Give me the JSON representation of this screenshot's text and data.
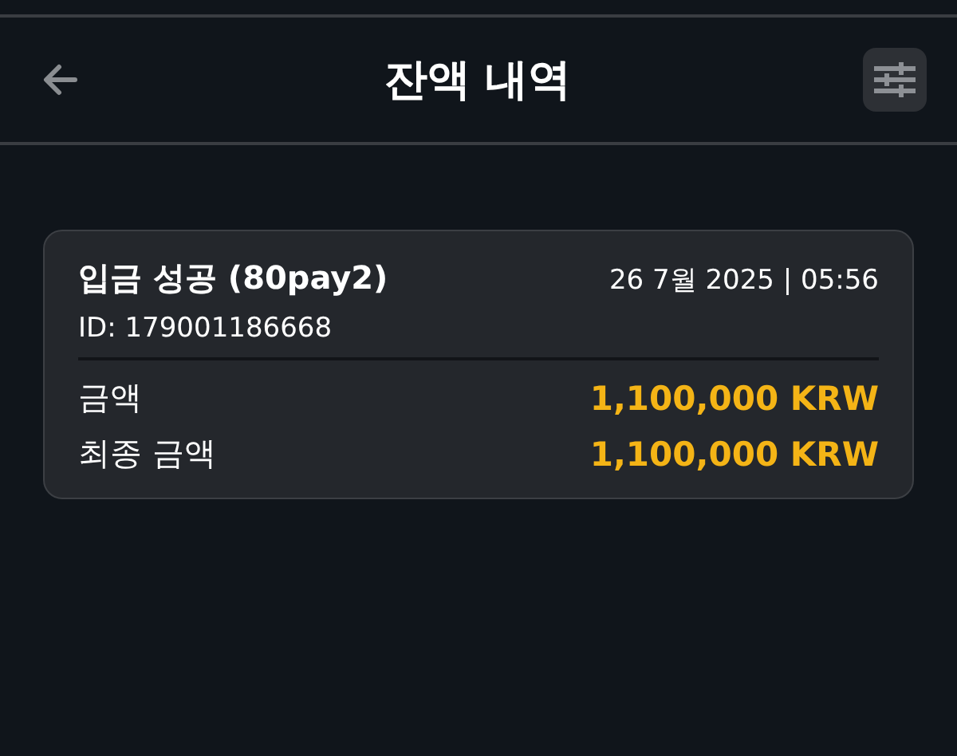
{
  "header": {
    "title": "잔액 내역"
  },
  "transaction": {
    "title": "입금 성공 (80pay2)",
    "date": "26 7월 2025 | 05:56",
    "id": "ID: 179001186668",
    "rows": [
      {
        "label": "금액",
        "value": "1,100,000 KRW"
      },
      {
        "label": "최종 금액",
        "value": "1,100,000 KRW"
      }
    ]
  }
}
